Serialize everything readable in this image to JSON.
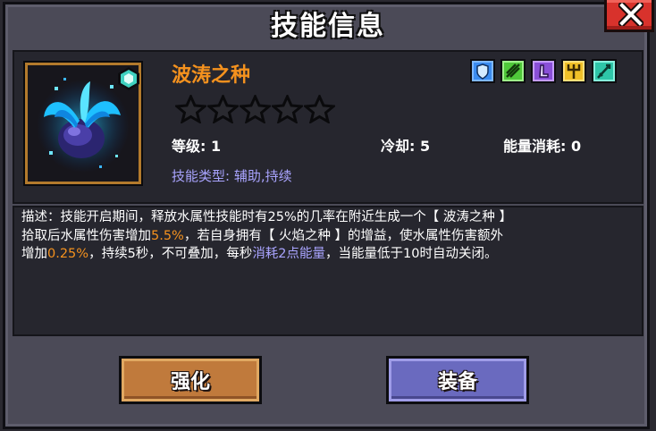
{
  "header": {
    "title": "技能信息"
  },
  "skill": {
    "name": "波涛之种",
    "star_rating": {
      "filled": 0,
      "max": 5
    },
    "level_label": "等级: 1",
    "cooldown_label": "冷却: 5",
    "energy_label": "能量消耗: 0",
    "type_label": "技能类型: 辅助,持续"
  },
  "elements": [
    {
      "name": "water-shield-icon",
      "color": "#3b8cf0"
    },
    {
      "name": "nature-icon",
      "color": "#4fc83a"
    },
    {
      "name": "shadow-icon",
      "color": "#8a4fd8"
    },
    {
      "name": "trident-icon",
      "color": "#f0c028"
    },
    {
      "name": "sword-icon",
      "color": "#2ec6a8"
    }
  ],
  "description": {
    "p1": "描述：技能开启期间，释放水属性技能时有25%的几率在附近生成一个【 波涛之种 】",
    "p2a": "拾取后水属性伤害增加",
    "p2b": "5.5%",
    "p2c": "，若自身拥有【 火焰之种 】的增益，使水属性伤害额外",
    "p3a": "增加",
    "p3b": "0.25%",
    "p3c": "，持续5秒，不可叠加，每秒",
    "p3d": "消耗2点能量",
    "p3e": "，当能量低于10时自动关闭。"
  },
  "buttons": {
    "upgrade": "强化",
    "equip": "装备"
  },
  "colors": {
    "accent_orange": "#f5921e",
    "accent_purple": "#a9a4ff",
    "panel_bg": "#4b4a57",
    "inner_bg": "#26262e"
  }
}
